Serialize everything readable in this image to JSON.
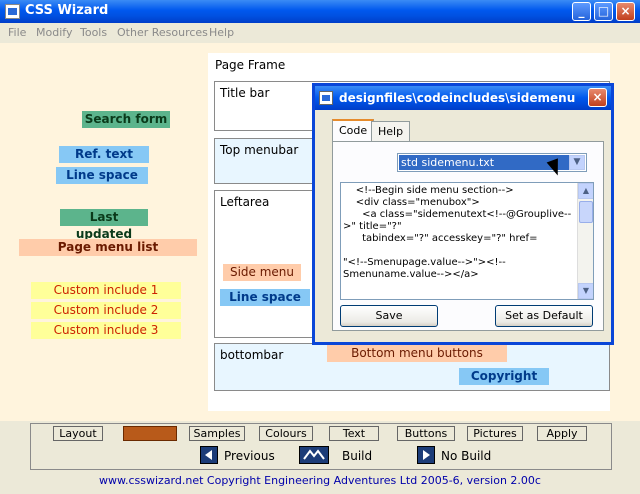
{
  "window": {
    "title": "CSS Wizard"
  },
  "menu": [
    "File",
    "Modify",
    "Tools",
    "Other Resources",
    "Help"
  ],
  "page_frame": {
    "label": "Page Frame",
    "title_bar": "Title bar",
    "top_menubar": "Top menubar",
    "leftarea": "Leftarea",
    "bottombar": "bottombar"
  },
  "left_tags": {
    "search_form": "Search form",
    "ref_text": "Ref. text",
    "line_space": "Line space",
    "last_updated": "Last updated",
    "page_menu_list": "Page menu list",
    "custom1": "Custom include 1",
    "custom2": "Custom include 2",
    "custom3": "Custom include 3"
  },
  "frame_tags": {
    "side_menu": "Side menu",
    "line_space": "Line space",
    "bottom_menu_buttons": "Bottom menu buttons",
    "copyright": "Copyright"
  },
  "dialog": {
    "title": "designfiles\\codeincludes\\sidemenu",
    "tabs": [
      "Code",
      "Help"
    ],
    "selected_file": "std sidemenu.txt",
    "code": "    <!--Begin side menu section-->\n    <div class=\"menubox\">\n      <a class=\"sidemenutext<!--@Grouplive-->\" title=\"?\"\n      tabindex=\"?\" accesskey=\"?\" href=\n\n\"<!--Smenupage.value-->\"><!--Smenuname.value--></a>",
    "save_label": "Save",
    "default_label": "Set as Default"
  },
  "toolbar": {
    "buttons": [
      "Layout",
      "Samples",
      "Colours",
      "Text",
      "Buttons",
      "Pictures",
      "Apply"
    ],
    "highlight_label": "",
    "previous": "Previous",
    "build": "Build",
    "no_build": "No Build"
  },
  "footer": "www.csswizard.net Copyright Engineering Adventures Ltd 2005-6,  version 2.00c"
}
